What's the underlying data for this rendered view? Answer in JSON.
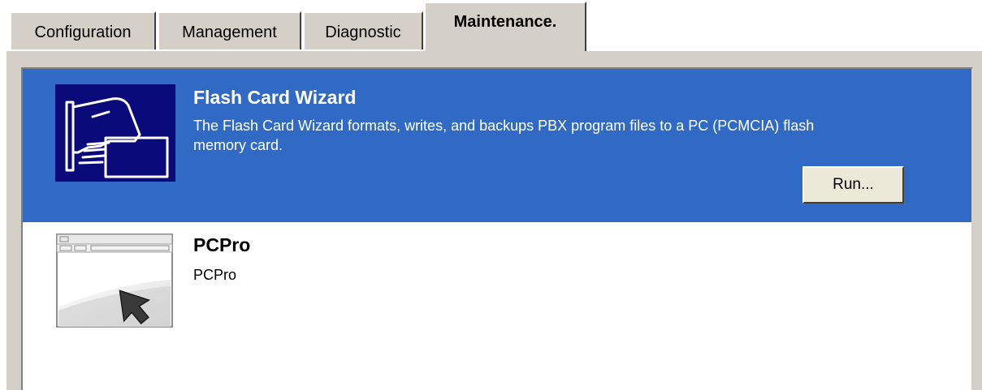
{
  "tabs": [
    {
      "label": "Configuration",
      "active": false
    },
    {
      "label": "Management",
      "active": false
    },
    {
      "label": "Diagnostic",
      "active": false
    },
    {
      "label": "Maintenance.",
      "active": true
    }
  ],
  "items": [
    {
      "title": "Flash Card Wizard",
      "description": "The Flash Card Wizard formats, writes, and backups PBX program files to a PC (PCMCIA) flash memory card.",
      "button_label": "Run...",
      "icon": "flash-card-icon",
      "selected": true
    },
    {
      "title": "PCPro",
      "description": "PCPro",
      "icon": "pcpro-window-icon",
      "selected": false
    }
  ],
  "colors": {
    "selection": "#316ac5",
    "panel": "#d4d0c8",
    "icon_background": "#0a0a7a"
  }
}
